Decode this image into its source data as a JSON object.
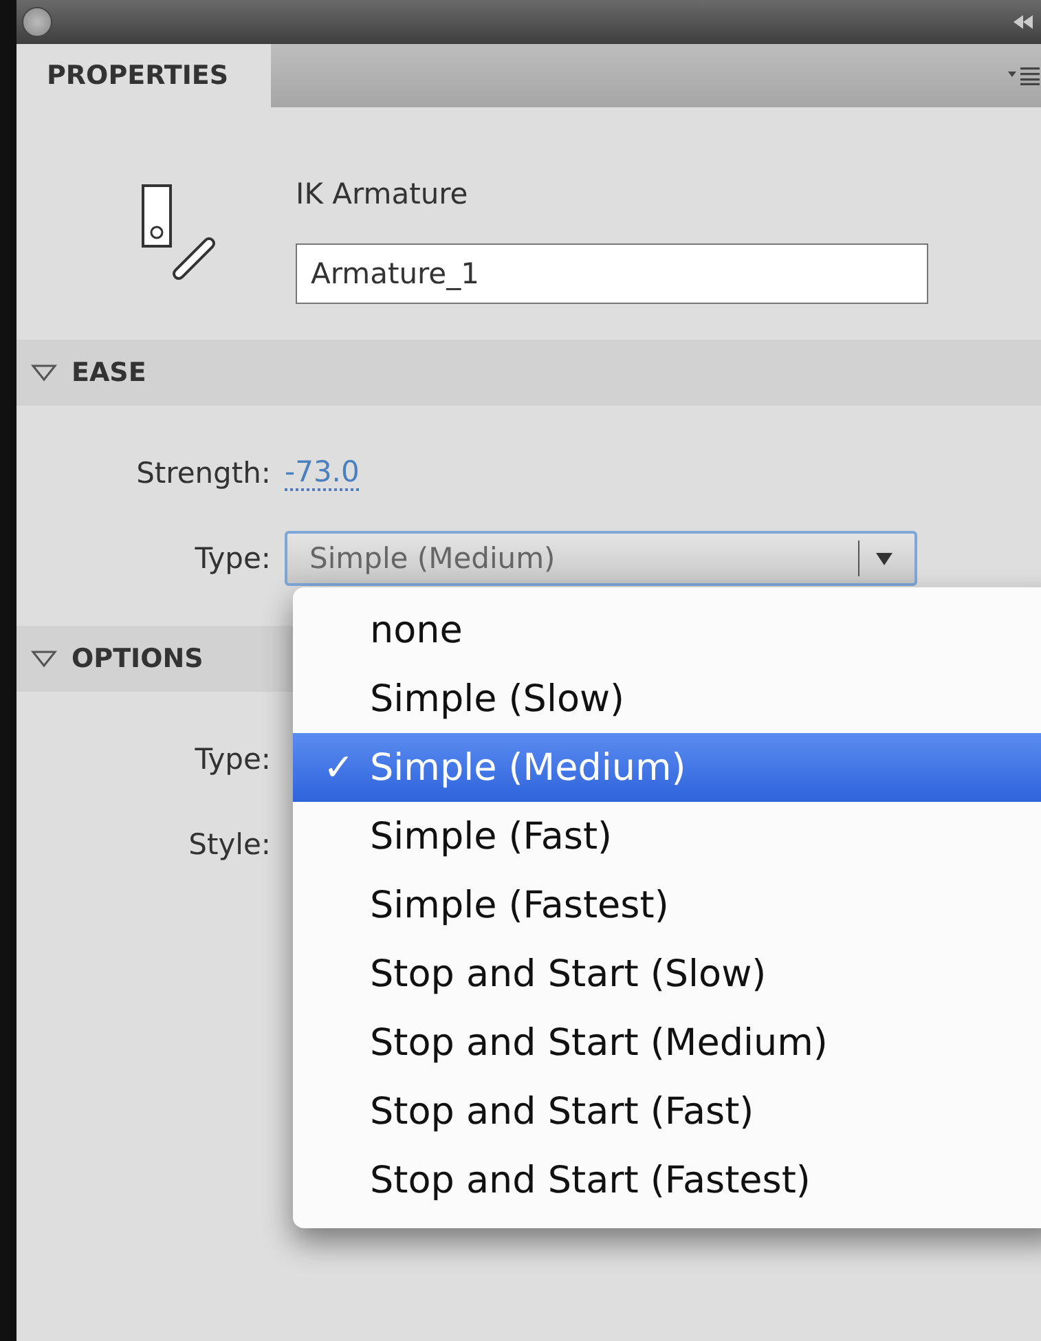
{
  "panel": {
    "tab": "PROPERTIES"
  },
  "header": {
    "title": "IK Armature",
    "name_value": "Armature_1"
  },
  "sections": [
    {
      "title": "EASE",
      "expanded": true,
      "rows": [
        {
          "kind": "link",
          "label": "Strength:",
          "value": "-73.0"
        },
        {
          "kind": "dropdown",
          "label": "Type:",
          "value": "Simple (Medium)"
        }
      ]
    },
    {
      "title": "OPTIONS",
      "expanded": true,
      "rows": [
        {
          "kind": "hidden",
          "label": "Type:"
        },
        {
          "kind": "hidden",
          "label": "Style:"
        }
      ]
    }
  ],
  "menu": {
    "check": "✓",
    "items": [
      {
        "label": "none",
        "selected": false
      },
      {
        "label": "Simple (Slow)",
        "selected": false
      },
      {
        "label": "Simple (Medium)",
        "selected": true
      },
      {
        "label": "Simple (Fast)",
        "selected": false
      },
      {
        "label": "Simple (Fastest)",
        "selected": false
      },
      {
        "label": "Stop and Start (Slow)",
        "selected": false
      },
      {
        "label": "Stop and Start (Medium)",
        "selected": false
      },
      {
        "label": "Stop and Start (Fast)",
        "selected": false
      },
      {
        "label": "Stop and Start (Fastest)",
        "selected": false
      }
    ]
  }
}
